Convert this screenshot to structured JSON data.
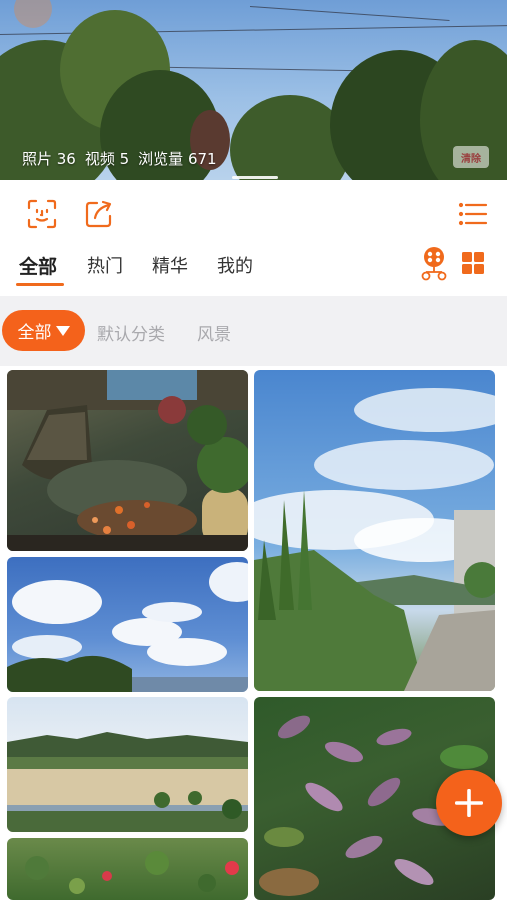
{
  "cover": {
    "stats": {
      "photos": "照片 36",
      "videos": "视频 5",
      "views": "浏览量 671"
    },
    "badge": "清除"
  },
  "actions": {
    "left_icons": [
      "face-scan-icon",
      "share-icon"
    ],
    "right_icon": "list-menu-icon"
  },
  "tabs": [
    {
      "label": "全部",
      "active": true
    },
    {
      "label": "热门",
      "active": false
    },
    {
      "label": "精华",
      "active": false
    },
    {
      "label": "我的",
      "active": false
    }
  ],
  "tab_icons": [
    "people-network-icon",
    "grid-view-icon"
  ],
  "filters": {
    "active": "全部",
    "items": [
      "默认分类",
      "风景"
    ]
  },
  "photos": [
    "pond-with-boat-and-koi-photo",
    "sky-and-plants-path-photo",
    "blue-sky-clouds-photo",
    "lake-and-mountains-photo",
    "purple-leaf-plants-photo",
    "flowers-garden-photo"
  ],
  "fab": "add-icon",
  "colors": {
    "accent": "#f4621b",
    "filter_bg": "#f1f1f3",
    "muted_text": "#a9a9ad"
  }
}
